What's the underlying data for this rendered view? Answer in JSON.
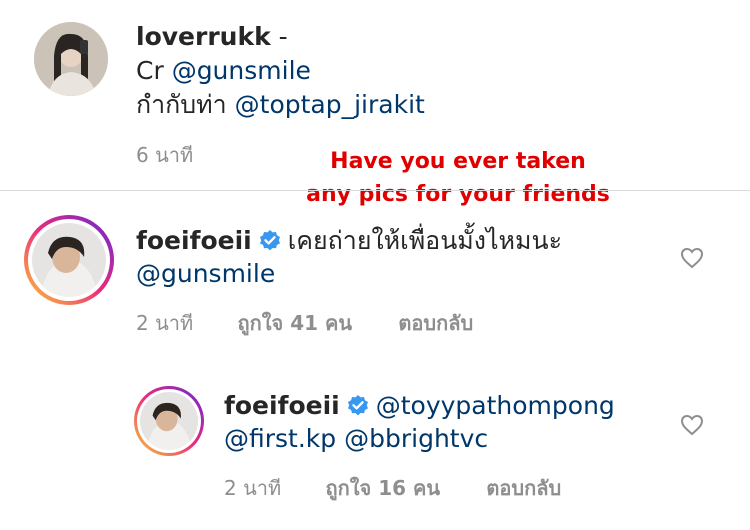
{
  "post": {
    "username": "loverrukk",
    "separator": "-",
    "line1_prefix": "Cr",
    "line1_mention": "@gunsmile",
    "line2_prefix": "กำกับท่า",
    "line2_mention": "@toptap_jirakit",
    "time": "6 นาที"
  },
  "overlay": {
    "line1": "Have you ever taken",
    "line2": "any pics for your friends"
  },
  "comments": [
    {
      "username": "foeifoeii",
      "text": "เคยถ่ายให้เพื่อนมั้งไหมนะ",
      "mention": "@gunsmile",
      "time": "2 นาที",
      "likes": "ถูกใจ 41 คน",
      "reply": "ตอบกลับ"
    },
    {
      "username": "foeifoeii",
      "mention1": "@toyypathompong",
      "mention2": "@first.kp",
      "mention3": "@bbrightvc",
      "time": "2 นาที",
      "likes": "ถูกใจ 16 คน",
      "reply": "ตอบกลับ"
    }
  ],
  "colors": {
    "mention": "#00376b",
    "meta": "#8e8e8e",
    "overlay": "#e00000",
    "verified": "#3897f0"
  },
  "icons": [
    "verified-badge-icon",
    "heart-icon"
  ]
}
